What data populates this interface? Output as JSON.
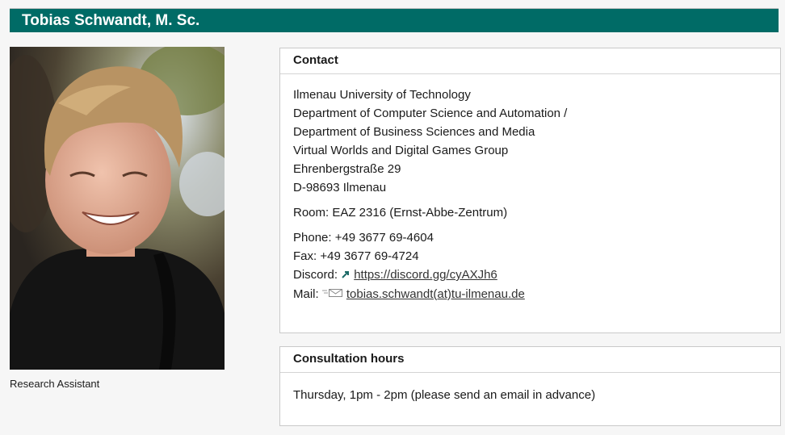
{
  "header": {
    "title": "Tobias Schwandt, M. Sc."
  },
  "profile": {
    "caption": "Research Assistant",
    "photo_icon": "portrait-photo"
  },
  "contact": {
    "heading": "Contact",
    "address": [
      "Ilmenau University of Technology",
      "Department of Computer Science and Automation /",
      "Department of Business Sciences and Media",
      "Virtual Worlds and Digital Games Group",
      "Ehrenbergstraße 29",
      "D-98693 Ilmenau"
    ],
    "room": "Room: EAZ 2316 (Ernst-Abbe-Zentrum)",
    "phone": "Phone: +49 3677 69-4604",
    "fax": "Fax: +49 3677 69-4724",
    "discord_label": "Discord:",
    "discord_link": "https://discord.gg/cyAXJh6",
    "mail_label": "Mail:",
    "mail_link": "tobias.schwandt(at)tu-ilmenau.de"
  },
  "consultation": {
    "heading": "Consultation hours",
    "text": "Thursday, 1pm - 2pm (please send an email in advance)"
  },
  "colors": {
    "title_bar": "#006b66",
    "title_text": "#ffffff"
  }
}
